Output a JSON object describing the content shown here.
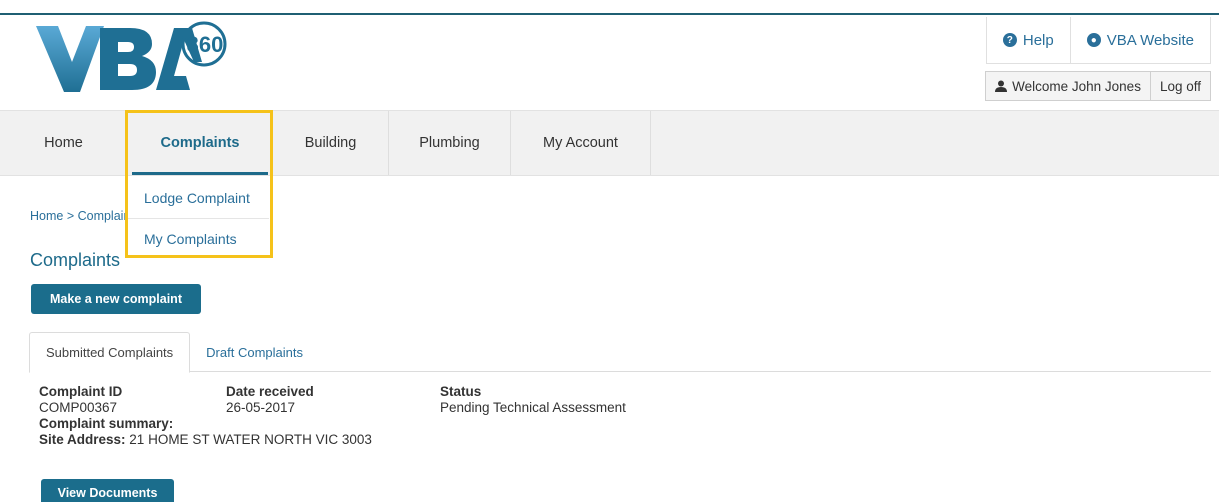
{
  "logo": {
    "text": "VBA",
    "circle_text": "360",
    "colors": {
      "dark": "#1f6f94",
      "light": "#5aa9d6"
    }
  },
  "header_links": {
    "help_label": "Help",
    "vba_website_label": "VBA Website",
    "welcome_label": "Welcome John Jones",
    "logoff_label": "Log off"
  },
  "nav": {
    "items": [
      {
        "label": "Home"
      },
      {
        "label": "Complaints"
      },
      {
        "label": "Building"
      },
      {
        "label": "Plumbing"
      },
      {
        "label": "My Account"
      }
    ],
    "dropdown": [
      {
        "label": "Lodge Complaint"
      },
      {
        "label": "My Complaints"
      }
    ]
  },
  "breadcrumb": "Home > Complaints",
  "page_title": "Complaints",
  "new_complaint_button": "Make a new complaint",
  "tabs": [
    {
      "label": "Submitted Complaints"
    },
    {
      "label": "Draft Complaints"
    }
  ],
  "complaint": {
    "id_header": "Complaint ID",
    "id": "COMP00367",
    "date_header": "Date received",
    "date": "26-05-2017",
    "status_header": "Status",
    "status": "Pending Technical Assessment",
    "summary_label": "Complaint summary:",
    "site_address_label": "Site Address:",
    "site_address": "21 HOME ST WATER NORTH VIC 3003"
  },
  "view_documents_button": "View Documents",
  "colors": {
    "accent": "#1b6d8c",
    "highlight": "#f5c21a"
  }
}
